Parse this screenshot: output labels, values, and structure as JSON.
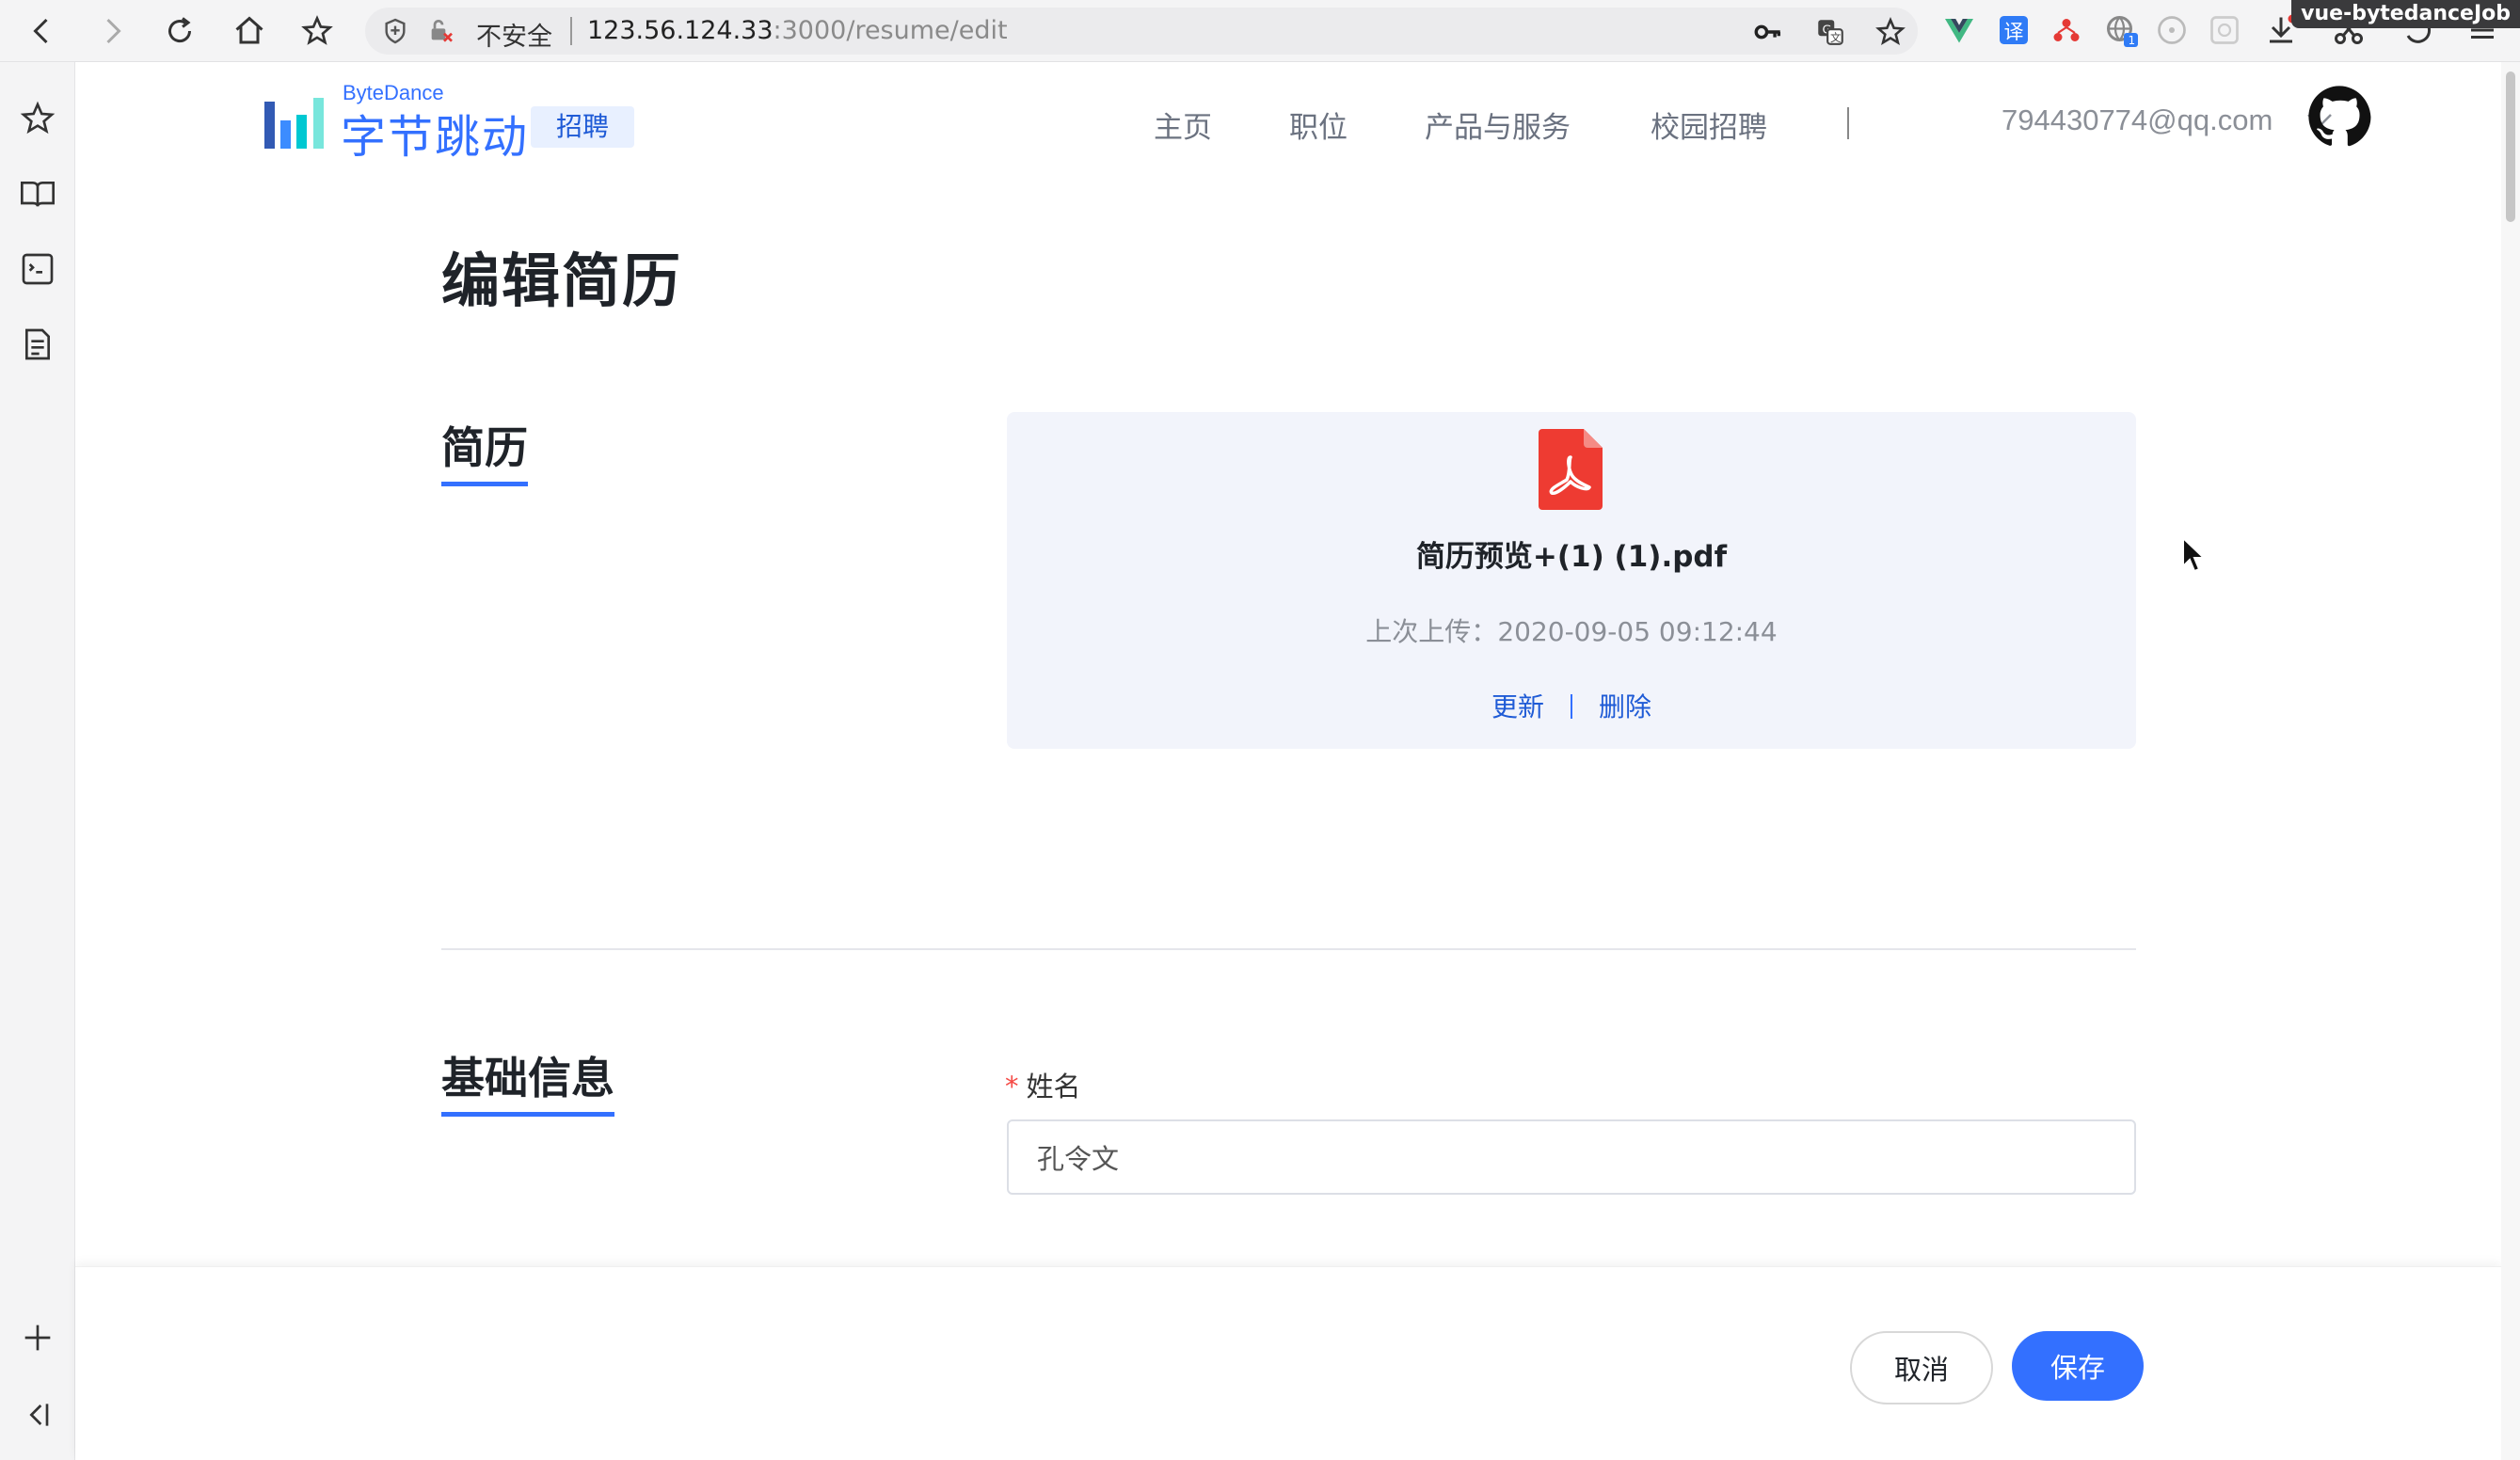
{
  "browser": {
    "insecure_label": "不安全",
    "url_host": "123.56.124.33",
    "url_rest": ":3000/resume/edit",
    "repo_badge": "vue-bytedanceJob",
    "ext_badge_count": "1"
  },
  "header": {
    "logo_en": "ByteDance",
    "logo_cn": "字节跳动",
    "logo_tag": "招聘",
    "nav": [
      "主页",
      "职位",
      "产品与服务",
      "校园招聘"
    ],
    "divider": "|",
    "user_email": "794430774@qq.com"
  },
  "main": {
    "page_title": "编辑简历",
    "resume_section_title": "简历",
    "resume": {
      "filename": "简历预览+(1) (1).pdf",
      "last_upload_label": "上次上传：",
      "last_upload_time": "2020-09-05 09:12:44",
      "update_label": "更新",
      "delete_label": "删除"
    },
    "basic_section_title": "基础信息",
    "name_field": {
      "required_mark": "*",
      "label": "姓名",
      "value": "孔令文"
    }
  },
  "footer": {
    "cancel_label": "取消",
    "save_label": "保存"
  },
  "colors": {
    "accent": "#3370ff",
    "pdf_red": "#ee3b32",
    "required": "#f54a45"
  }
}
